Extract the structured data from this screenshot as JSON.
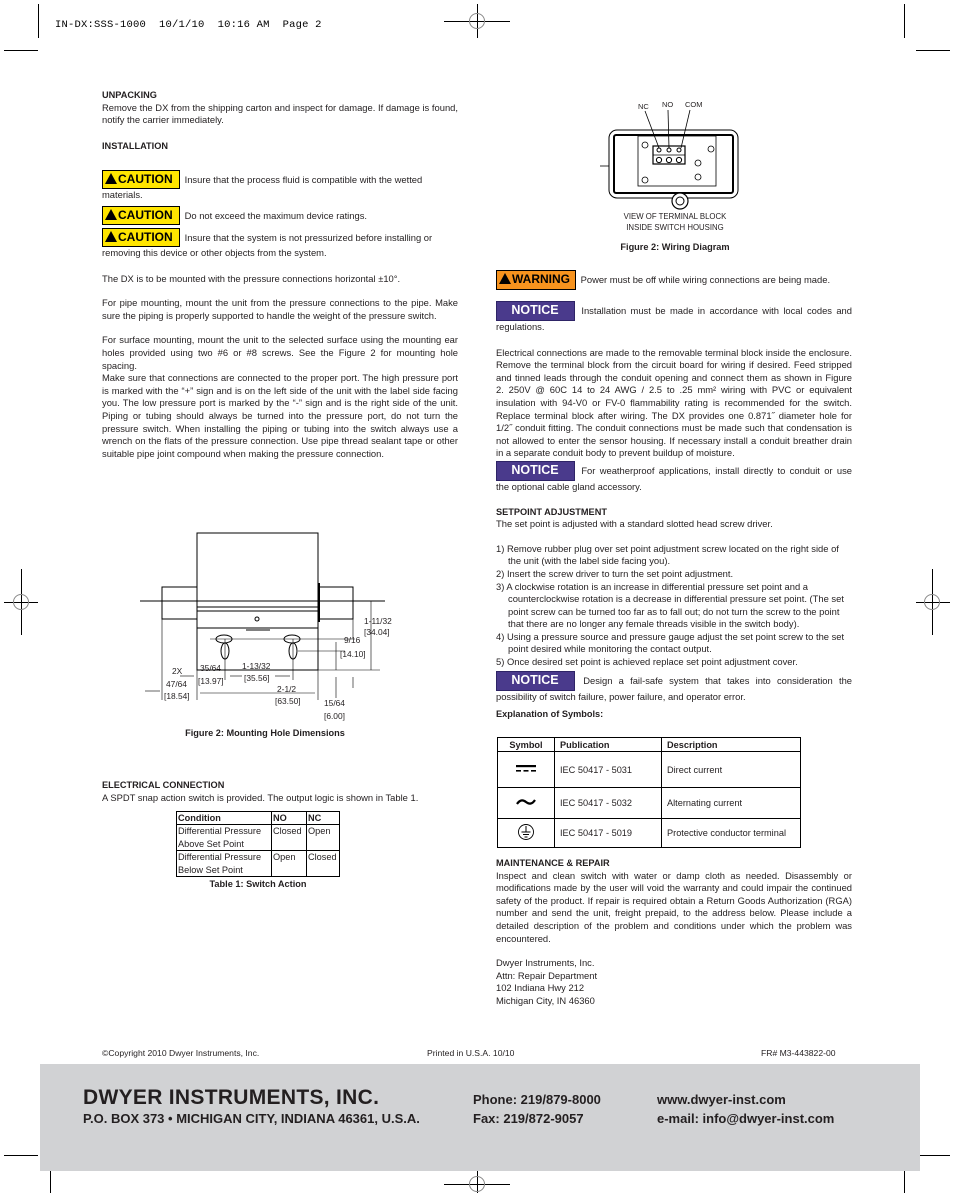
{
  "print_header": {
    "slug": "IN-DX:SSS-1000",
    "date": "10/1/10",
    "time": "10:16 AM",
    "page": "Page 2"
  },
  "left": {
    "unpacking": {
      "heading": "UNPACKING",
      "body": "Remove the DX from the shipping carton and inspect for damage. If damage is found, notify the carrier immediately."
    },
    "installation": {
      "heading": "INSTALLATION",
      "cautions": [
        {
          "label": "CAUTION",
          "text": "Insure that the process fluid is compatible with the wetted materials."
        },
        {
          "label": "CAUTION",
          "text": "Do not exceed the maximum device ratings."
        },
        {
          "label": "CAUTION",
          "text": "Insure that the system is not pressurized before installing or removing this device or other objects from the system."
        }
      ],
      "p1": "The DX is to be mounted with the pressure connections horizontal ±10°.",
      "p2": "For pipe mounting, mount the unit from the pressure connections to the pipe. Make sure the piping is properly supported to handle the weight of the pressure switch.",
      "p3": "For surface mounting, mount the unit to the selected surface using the mounting ear holes provided using two #6 or #8 screws. See the Figure 2 for mounting hole spacing.",
      "p4": "Make sure that connections are connected to the proper port. The high pressure port is marked with the “+” sign and is on the left side of the unit with the label side facing you. The low pressure port is marked by the “-” sign and is the right side of the unit. Piping or tubing should always be turned into the pressure port, do not turn the pressure switch. When installing the piping or tubing into the switch always use a wrench on the flats of the pressure connection. Use pipe thread sealant tape or other suitable pipe joint compound when making the pressure connection."
    },
    "figure_mounting": {
      "caption": "Figure 2: Mounting Hole Dimensions",
      "dims": {
        "d1_in": "1-11/32",
        "d1_mm": "[34.04]",
        "d2_in": "9/16",
        "d2_mm": "[14.10]",
        "d3_in": "1-13/32",
        "d3_mm": "[35.56]",
        "d4_in": "35/64",
        "d4_mm": "[13.97]",
        "d5_prefix": "2X",
        "d5_in": "47/64",
        "d5_mm": "[18.54]",
        "d6_in": "2-1/2",
        "d6_mm": "[63.50]",
        "d7_in": "15/64",
        "d7_mm": "[6.00]"
      }
    },
    "electrical": {
      "heading": "ELECTRICAL CONNECTION",
      "body": "A SPDT snap action switch is provided. The output logic is shown in Table 1.",
      "table": {
        "headers": [
          "Condition",
          "NO",
          "NC"
        ],
        "rows": [
          [
            "Differential Pressure Above Set Point",
            "Closed",
            "Open"
          ],
          [
            "Differential Pressure Below Set Point",
            "Open",
            "Closed"
          ]
        ],
        "caption": "Table 1: Switch Action"
      }
    }
  },
  "right": {
    "figure_wiring": {
      "labels": [
        "NC",
        "NO",
        "COM"
      ],
      "view_line1": "VIEW OF TERMINAL BLOCK",
      "view_line2": "INSIDE SWITCH HOUSING",
      "caption": "Figure 2: Wiring Diagram"
    },
    "warning": {
      "label": "WARNING",
      "text": "Power must be off while wiring connections are being made."
    },
    "notice1": {
      "label": "NOTICE",
      "text": "Installation must be made in accordance with local codes and regulations."
    },
    "electrical_body": "Electrical connections are made to the removable terminal block inside the enclosure. Remove the terminal block from the circuit board for wiring if desired. Feed stripped and tinned leads through the conduit opening and connect them as shown in Figure 2. 250V @ 60C 14 to 24 AWG / 2.5 to .25 mm² wiring with PVC or equivalent insulation with 94-V0 or FV-0 flammability rating is recommended for the switch. Replace terminal block after wiring. The DX provides one 0.871˝ diameter hole for 1/2˝ conduit fitting. The conduit connections must be made such that condensation is not allowed to enter the sensor housing. If necessary install a conduit breather drain in a separate conduit body to prevent buildup of moisture.",
    "notice2": {
      "label": "NOTICE",
      "text": "For weatherproof applications, install directly to conduit or use the optional cable gland accessory."
    },
    "setpoint": {
      "heading": "SETPOINT ADJUSTMENT",
      "intro": "The set point is adjusted with a standard slotted head screw driver.",
      "steps": [
        "1) Remove rubber plug over set point adjustment screw located on the right side of the unit (with the label side facing you).",
        "2) Insert the screw driver to turn the set point adjustment.",
        "3) A clockwise rotation is an increase in differential pressure set point and a counterclockwise rotation is a decrease in differential pressure set point. (The set point screw can be turned too far as to fall out; do not turn the screw to the point that there are no longer any female threads visible in the switch body).",
        "4) Using a pressure source and pressure gauge adjust the set point screw to the set point desired while monitoring the contact output.",
        "5) Once desired set point is achieved replace set point adjustment cover."
      ]
    },
    "notice3": {
      "label": "NOTICE",
      "text": "Design a fail-safe system that takes into consideration the possibility of switch failure, power failure, and operator error."
    },
    "symbols": {
      "title": "Explanation of Symbols:",
      "headers": [
        "Symbol",
        "Publication",
        "Description"
      ],
      "rows": [
        {
          "icon": "direct-current-icon",
          "publication": "IEC 50417 - 5031",
          "description": "Direct current"
        },
        {
          "icon": "alternating-current-icon",
          "publication": "IEC 50417 - 5032",
          "description": "Alternating current"
        },
        {
          "icon": "protective-earth-icon",
          "publication": "IEC 50417 - 5019",
          "description": "Protective conductor terminal"
        }
      ]
    },
    "maintenance": {
      "heading": "MAINTENANCE & REPAIR",
      "body": "Inspect and clean switch with water or damp cloth as needed. Disassembly or modifications made by the user will void the warranty and could impair the continued safety of the product. If repair is required obtain a Return Goods Authorization (RGA) number and send the unit, freight prepaid, to the address below. Please include a detailed description of the problem and conditions under which the problem was encountered.",
      "address": [
        "Dwyer Instruments, Inc.",
        "Attn: Repair Department",
        "102 Indiana Hwy 212",
        "Michigan City, IN 46360"
      ]
    }
  },
  "footer": {
    "copyright": "©Copyright 2010 Dwyer Instruments, Inc.",
    "printed": "Printed in U.S.A. 10/10",
    "fr": "FR# M3-443822-00",
    "company": "DWYER INSTRUMENTS, INC.",
    "address": "P.O. BOX 373 • MICHIGAN CITY, INDIANA 46361, U.S.A.",
    "phone": "Phone: 219/879-8000",
    "fax": "Fax: 219/872-9057",
    "web": "www.dwyer-inst.com",
    "email": "e-mail: info@dwyer-inst.com"
  },
  "colors": {
    "caution": "#ffe500",
    "warning": "#f7931e",
    "notice": "#4a3a8c",
    "footer_band": "#d1d2d4"
  }
}
